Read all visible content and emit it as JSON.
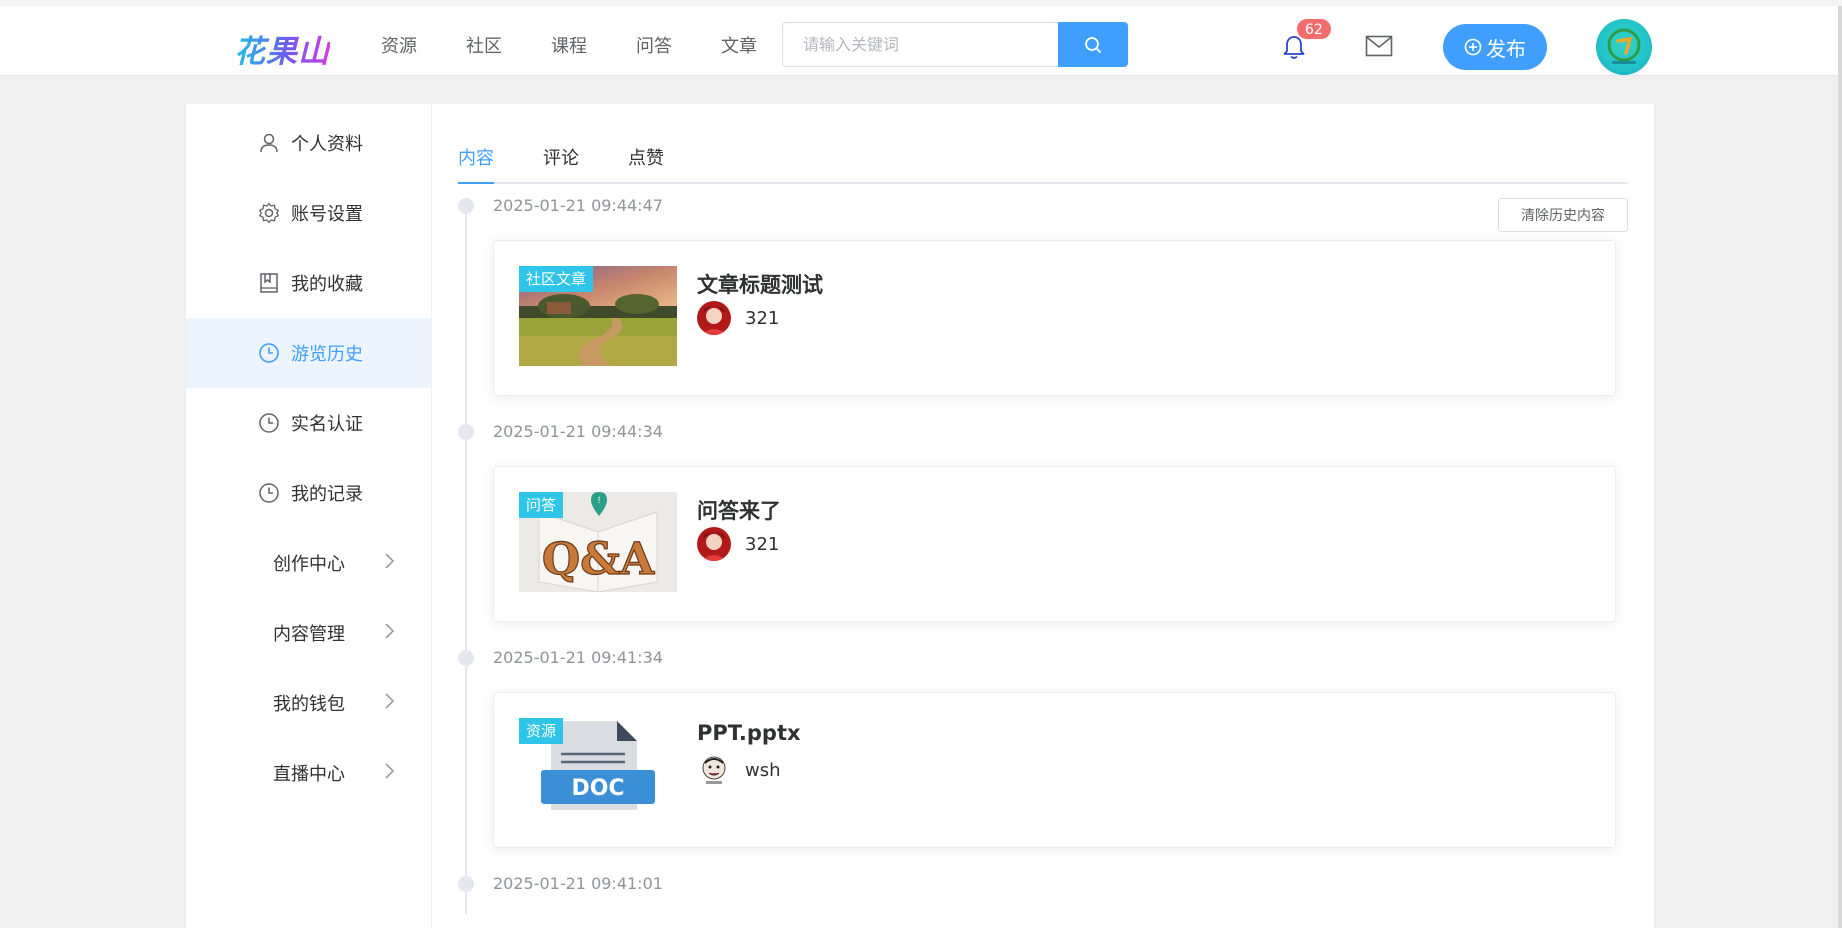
{
  "header": {
    "logo": "花果山",
    "nav": [
      "资源",
      "社区",
      "课程",
      "问答",
      "文章"
    ],
    "search_placeholder": "请输入关键词",
    "notification_count": "62",
    "publish_label": "发布"
  },
  "sidebar": {
    "items": [
      {
        "label": "个人资料",
        "icon": "user-icon"
      },
      {
        "label": "账号设置",
        "icon": "gear-icon"
      },
      {
        "label": "我的收藏",
        "icon": "bookmark-icon"
      },
      {
        "label": "游览历史",
        "icon": "clock-icon"
      },
      {
        "label": "实名认证",
        "icon": "clock-icon"
      },
      {
        "label": "我的记录",
        "icon": "clock-icon"
      }
    ],
    "active_item": "游览历史",
    "submenus": [
      "创作中心",
      "内容管理",
      "我的钱包",
      "直播中心"
    ]
  },
  "main": {
    "tabs": [
      "内容",
      "评论",
      "点赞"
    ],
    "active_tab": "内容",
    "clear_button": "清除历史内容",
    "history": [
      {
        "time": "2025-01-21 09:44:47",
        "tag": "社区文章",
        "title": "文章标题测试",
        "author": "321"
      },
      {
        "time": "2025-01-21 09:44:34",
        "tag": "问答",
        "title": "问答来了",
        "author": "321"
      },
      {
        "time": "2025-01-21 09:41:34",
        "tag": "资源",
        "title": "PPT.pptx",
        "author": "wsh"
      },
      {
        "time": "2025-01-21 09:41:01"
      }
    ],
    "thumb_labels": {
      "qa": "Q&A",
      "doc": "DOC"
    }
  },
  "colors": {
    "accent": "#409eff",
    "tag": "#2ec5e8",
    "badge": "#f56c6c",
    "active_bg": "#ecf5ff"
  }
}
